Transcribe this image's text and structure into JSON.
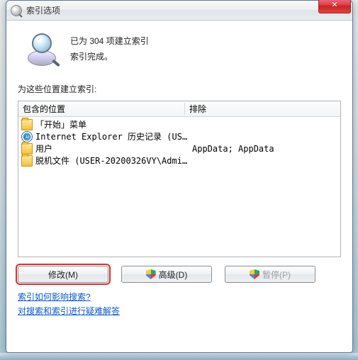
{
  "window": {
    "title": "索引选项",
    "close_glyph": "✕"
  },
  "status": {
    "indexed_line": "已为 304 项建立索引",
    "complete_line": "索引完成。"
  },
  "section_label": "为这些位置建立索引:",
  "columns": {
    "location": "包含的位置",
    "exclude": "排除"
  },
  "rows": [
    {
      "icon": "folder",
      "location": "「开始」菜单",
      "exclude": ""
    },
    {
      "icon": "ie",
      "location": "Internet Explorer 历史记录 (USE...",
      "exclude": ""
    },
    {
      "icon": "folder",
      "location": "用户",
      "exclude": "AppData; AppData"
    },
    {
      "icon": "folder",
      "location": "脱机文件 (USER-20200326VY\\Admin...",
      "exclude": ""
    }
  ],
  "buttons": {
    "modify": "修改(M)",
    "advanced": "高级(D)",
    "pause": "暂停(P)"
  },
  "links": {
    "how_affect": "索引如何影响搜索?",
    "troubleshoot": "对搜索和索引进行疑难解答"
  }
}
